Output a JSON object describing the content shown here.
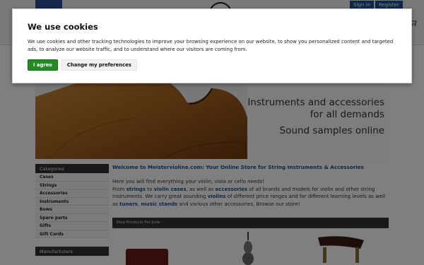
{
  "header": {
    "login_links": [
      "Sign in",
      "Register"
    ]
  },
  "hero": {
    "line1": "Instruments and accessories",
    "line2": "for all demands",
    "line3": "Sound samples online"
  },
  "sidebar": {
    "categories_header": "Categories",
    "items": [
      "Cases",
      "Strings",
      "Accessories",
      "Instruments",
      "Bows",
      "Spare parts",
      "Gifts",
      "Gift Cards"
    ],
    "manufacturers_header": "Manufacturers"
  },
  "main": {
    "welcome_title": "Welcome to Meistervioline.com: Your Online Store for String Instruments & Accessories",
    "intro": "Here you will find everything your violin, viola or cello needs!",
    "from": "From ",
    "link_strings": "strings",
    "to": " to ",
    "link_violin_cases": "violin cases",
    "as_well_as": ", as well as ",
    "link_accessories": "accessories",
    "rest1": " of all brands and models for violin and other string instruments. We carry great sounding ",
    "link_violins": "violins",
    "rest2": " of different price ranges and for different learning levels as well as ",
    "link_tuners": "tuners",
    "comma": ", ",
    "link_music_stands": "music stands",
    "rest3": " and various other accessories. Browse our store!",
    "new_products_header": "New Products For June"
  },
  "cookie_banner": {
    "title": "We use cookies",
    "text": "We use cookies and other tracking technologies to improve your browsing experience on our website, to show you personalized content and targeted ads, to analyze our website traffic, and to understand where our visitors are coming from.",
    "agree_label": "I agree",
    "prefs_label": "Change my preferences"
  },
  "colors": {
    "agree_green": "#228b22",
    "link_blue": "#1d4f94",
    "overlay": "rgba(0,0,0,0.5)"
  },
  "icons": [
    "cart-icon",
    "logo-seal"
  ]
}
